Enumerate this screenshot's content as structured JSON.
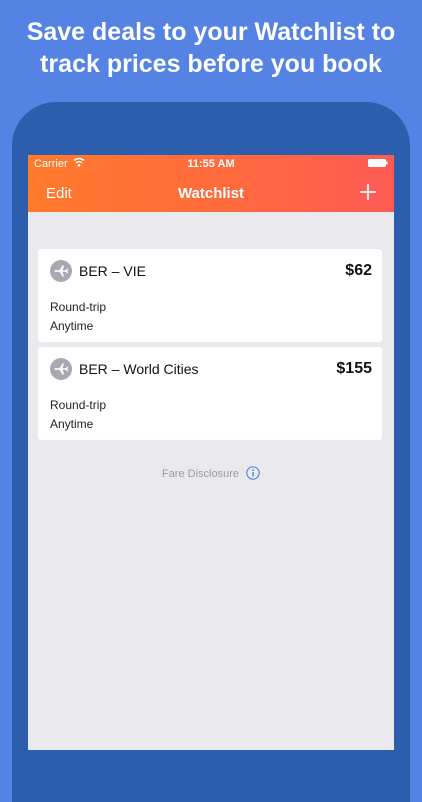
{
  "promo": {
    "line1": "Save deals to your Watchlist to",
    "line2": "track prices before you book"
  },
  "status_bar": {
    "carrier": "Carrier",
    "time": "11:55 AM"
  },
  "nav": {
    "edit_label": "Edit",
    "title": "Watchlist",
    "add_icon": "plus-icon"
  },
  "watchlist": [
    {
      "route": "BER – VIE",
      "price": "$62",
      "trip_type": "Round-trip",
      "period": "Anytime",
      "icon": "airplane-icon"
    },
    {
      "route": "BER – World Cities",
      "price": "$155",
      "trip_type": "Round-trip",
      "period": "Anytime",
      "icon": "airplane-icon"
    }
  ],
  "footer": {
    "disclosure_label": "Fare Disclosure",
    "info_icon": "info-icon"
  },
  "colors": {
    "background": "#5583e3",
    "device": "#2d5dad",
    "nav_gradient_start": "#ff7a2a",
    "nav_gradient_end": "#ff5b55",
    "screen_background": "#e9e9ee",
    "accent_info": "#3a7be0"
  }
}
